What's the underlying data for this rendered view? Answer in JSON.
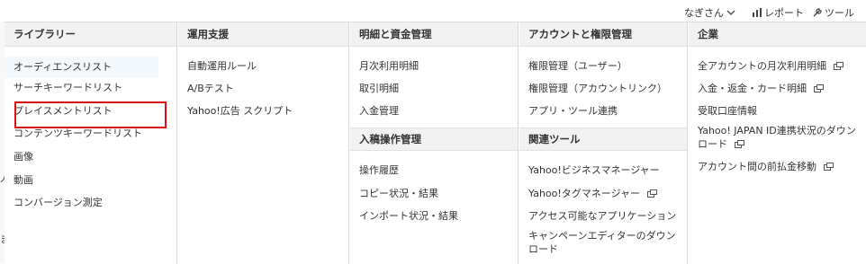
{
  "topbar": {
    "user_label": "なぎさん",
    "report_label": "レポート",
    "tools_label": "ツール"
  },
  "left_glyphs": [
    "人",
    "ま"
  ],
  "menu": {
    "library": {
      "heading": "ライブラリー",
      "items": [
        "オーディエンスリスト",
        "サーチキーワードリスト",
        "プレイスメントリスト",
        "コンテンツキーワードリスト",
        "画像",
        "動画",
        "コンバージョン測定"
      ]
    },
    "support": {
      "heading": "運用支援",
      "items": [
        "自動運用ルール",
        "A/Bテスト",
        "Yahoo!広告 スクリプト"
      ]
    },
    "billing": {
      "heading": "明細と資金管理",
      "items": [
        "月次利用明細",
        "取引明細",
        "入金管理"
      ],
      "sub_heading": "入稿操作管理",
      "sub_items": [
        "操作履歴",
        "コピー状況・結果",
        "インポート状況・結果"
      ]
    },
    "account": {
      "heading": "アカウントと権限管理",
      "items": [
        "権限管理（ユーザー）",
        "権限管理（アカウントリンク）",
        "アプリ・ツール連携"
      ],
      "sub_heading": "関連ツール",
      "sub_items": [
        "Yahoo!ビジネスマネージャー",
        "Yahoo!タグマネージャー",
        "アクセス可能なアプリケーション",
        "キャンペーンエディターのダウンロード"
      ]
    },
    "company": {
      "heading": "企業",
      "items": [
        "全アカウントの月次利用明細",
        "入金・返金・カード明細",
        "受取口座情報",
        "Yahoo! JAPAN ID連携状況のダウンロード",
        "アカウント間の前払金移動"
      ]
    }
  },
  "colors": {
    "highlight_border": "#e01010",
    "header_bg": "#f2f2f2",
    "active_bg": "#f3f8fc"
  }
}
